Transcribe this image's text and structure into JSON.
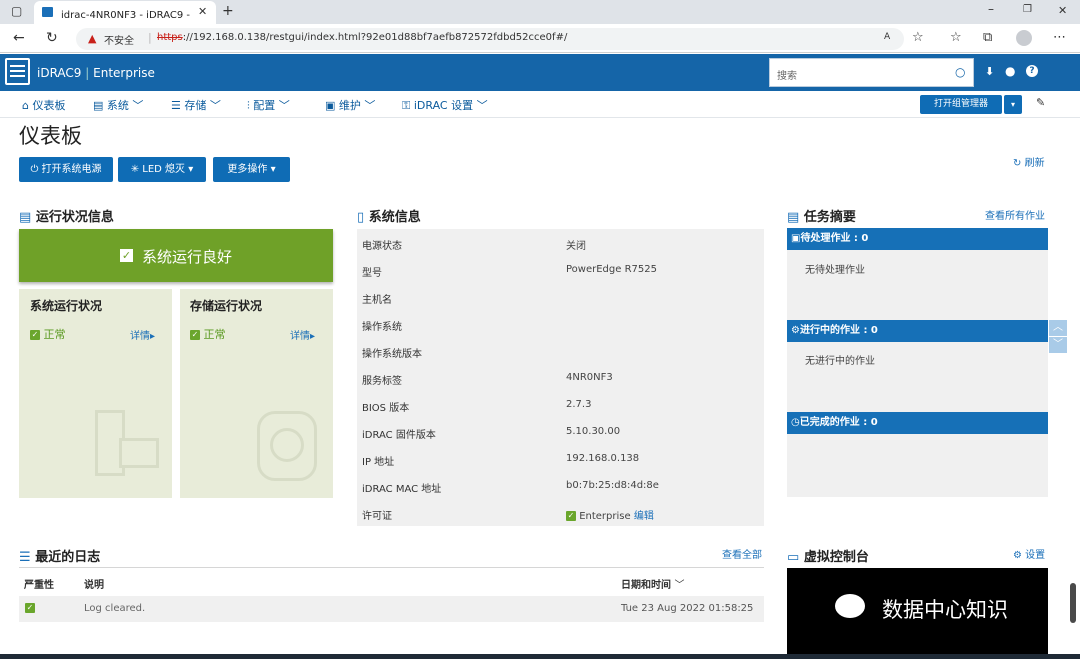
{
  "browser": {
    "tab_title": "idrac-4NR0NF3 - iDRAC9 - 仪表",
    "security_label": "不安全",
    "url_scheme": "https",
    "url_rest": "://192.168.0.138/restgui/index.html?92e01d88bf7aefb872572fdbd52cce0f#/"
  },
  "header": {
    "brand": "iDRAC9",
    "edition": "Enterprise",
    "search_placeholder": "搜索"
  },
  "nav": {
    "dashboard": "仪表板",
    "system": "系统",
    "storage": "存储",
    "config": "配置",
    "maintenance": "维护",
    "idrac_settings": "iDRAC 设置",
    "group_manager": "打开组管理器"
  },
  "page": {
    "title": "仪表板",
    "refresh": "刷新",
    "actions": {
      "power_on": "打开系统电源",
      "led": "LED 熄灭",
      "more": "更多操作"
    }
  },
  "health": {
    "title": "运行状况信息",
    "status": "系统运行良好",
    "system_title": "系统运行状况",
    "system_status": "正常",
    "system_detail": "详情",
    "storage_title": "存储运行状况",
    "storage_status": "正常",
    "storage_detail": "详情"
  },
  "sysinfo": {
    "title": "系统信息",
    "rows": [
      {
        "label": "电源状态",
        "value": "关闭"
      },
      {
        "label": "型号",
        "value": "PowerEdge R7525"
      },
      {
        "label": "主机名",
        "value": ""
      },
      {
        "label": "操作系统",
        "value": ""
      },
      {
        "label": "操作系统版本",
        "value": ""
      },
      {
        "label": "服务标签",
        "value": "4NR0NF3"
      },
      {
        "label": "BIOS 版本",
        "value": "2.7.3"
      },
      {
        "label": "iDRAC 固件版本",
        "value": "5.10.30.00"
      },
      {
        "label": "IP 地址",
        "value": "192.168.0.138"
      },
      {
        "label": "iDRAC MAC 地址",
        "value": "b0:7b:25:d8:4d:8e"
      },
      {
        "label": "许可证",
        "value": "Enterprise"
      }
    ],
    "license_edit": "编辑"
  },
  "tasks": {
    "title": "任务摘要",
    "view_all": "查看所有作业",
    "pending_title": "待处理作业 : 0",
    "pending_empty": "无待处理作业",
    "running_title": "进行中的作业 : 0",
    "running_empty": "无进行中的作业",
    "completed_title": "已完成的作业 : 0"
  },
  "logs": {
    "title": "最近的日志",
    "view_all": "查看全部",
    "col_severity": "严重性",
    "col_desc": "说明",
    "col_datetime": "日期和时间",
    "rows": [
      {
        "desc": "Log cleared.",
        "datetime": "Tue 23 Aug 2022 01:58:25"
      }
    ]
  },
  "console": {
    "title": "虚拟控制台",
    "settings": "设置",
    "watermark": "数据中心知识"
  },
  "colors": {
    "brand_blue": "#1565a8",
    "health_green": "#6fa128",
    "task_bar_blue": "#1670b7"
  }
}
